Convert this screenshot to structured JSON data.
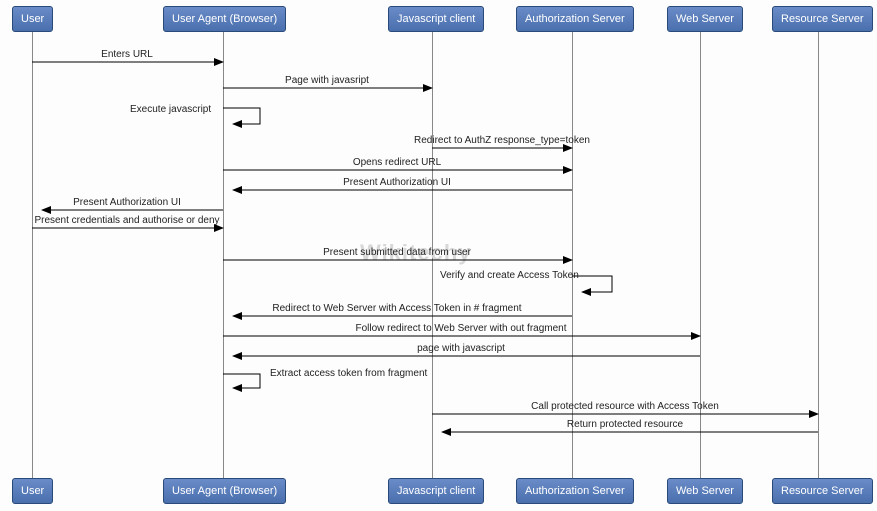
{
  "participants": {
    "user": "User",
    "browser": "User Agent (Browser)",
    "jsclient": "Javascript client",
    "authz": "Authorization Server",
    "webserver": "Web Server",
    "resource": "Resource Server"
  },
  "messages": {
    "m1": "Enters URL",
    "m2": "Page with javasript",
    "m3": "Execute javascript",
    "m4": "Redirect to AuthZ response_type=token",
    "m5": "Opens redirect URL",
    "m6": "Present Authorization UI",
    "m7": "Present Authorization UI",
    "m8": "Present credentials and authorise or deny",
    "m9": "Present submitted data from user",
    "m10": "Verify and create Access Token",
    "m11": "Redirect to Web Server with Access Token in # fragment",
    "m12": "Follow redirect to Web Server with out fragment",
    "m13": "page with javascript",
    "m14": "Extract access token from fragment",
    "m15": "Call protected resource with Access Token",
    "m16": "Return protected resource"
  },
  "watermark": "Wikitechy",
  "chart_data": {
    "type": "sequence-diagram",
    "participants": [
      "User",
      "User Agent (Browser)",
      "Javascript client",
      "Authorization Server",
      "Web Server",
      "Resource Server"
    ],
    "messages": [
      {
        "from": "User",
        "to": "User Agent (Browser)",
        "label": "Enters URL"
      },
      {
        "from": "User Agent (Browser)",
        "to": "Javascript client",
        "label": "Page with javasript"
      },
      {
        "from": "User Agent (Browser)",
        "to": "User Agent (Browser)",
        "label": "Execute javascript"
      },
      {
        "from": "Javascript client",
        "to": "Authorization Server",
        "label": "Redirect to AuthZ response_type=token"
      },
      {
        "from": "User Agent (Browser)",
        "to": "Authorization Server",
        "label": "Opens redirect URL"
      },
      {
        "from": "Authorization Server",
        "to": "User Agent (Browser)",
        "label": "Present Authorization UI"
      },
      {
        "from": "User Agent (Browser)",
        "to": "User",
        "label": "Present Authorization UI"
      },
      {
        "from": "User",
        "to": "User Agent (Browser)",
        "label": "Present credentials and authorise or deny"
      },
      {
        "from": "User Agent (Browser)",
        "to": "Authorization Server",
        "label": "Present submitted data from user"
      },
      {
        "from": "Authorization Server",
        "to": "Authorization Server",
        "label": "Verify and create Access Token"
      },
      {
        "from": "Authorization Server",
        "to": "User Agent (Browser)",
        "label": "Redirect to Web Server with Access Token in # fragment"
      },
      {
        "from": "User Agent (Browser)",
        "to": "Web Server",
        "label": "Follow redirect to Web Server with out fragment"
      },
      {
        "from": "Web Server",
        "to": "User Agent (Browser)",
        "label": "page with javascript"
      },
      {
        "from": "User Agent (Browser)",
        "to": "User Agent (Browser)",
        "label": "Extract access token from fragment"
      },
      {
        "from": "Javascript client",
        "to": "Resource Server",
        "label": "Call protected resource with Access Token"
      },
      {
        "from": "Resource Server",
        "to": "Javascript client",
        "label": "Return protected resource"
      }
    ]
  }
}
